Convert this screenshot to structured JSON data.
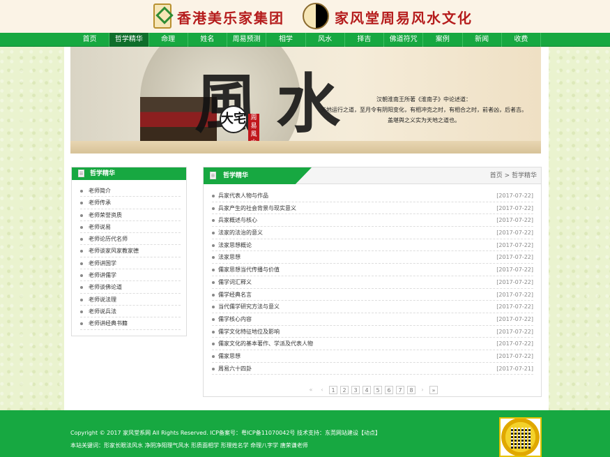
{
  "header": {
    "company_name": "香港美乐家集团",
    "brand_name": "家风堂周易风水文化"
  },
  "nav": {
    "items": [
      {
        "label": "首页",
        "active": false
      },
      {
        "label": "哲学精华",
        "active": true
      },
      {
        "label": "命理",
        "active": false
      },
      {
        "label": "姓名",
        "active": false
      },
      {
        "label": "周易预测",
        "active": false
      },
      {
        "label": "相学",
        "active": false
      },
      {
        "label": "风水",
        "active": false
      },
      {
        "label": "择吉",
        "active": false
      },
      {
        "label": "佛道符咒",
        "active": false
      },
      {
        "label": "案例",
        "active": false
      },
      {
        "label": "新闻",
        "active": false
      },
      {
        "label": "收费",
        "active": false
      }
    ]
  },
  "banner": {
    "char1": "風",
    "char2": "水",
    "seal": "大宅",
    "red_tag": "周易風水",
    "quote_line1": "汉朝淮南王所著《淮南子》中论述道：",
    "quote_line2": "天地运行之道，至月令有阴阳变化，有相冲克之时，有相合之时，前者凶，后者吉。",
    "quote_line3": "盖堪舆之义实为天地之道也。"
  },
  "sidebar": {
    "title": "哲学精华",
    "items": [
      "老师简介",
      "老师传承",
      "老师荣誉资质",
      "老师说易",
      "老师论历代名师",
      "老师谈家风家教家德",
      "老师讲国学",
      "老师讲儒学",
      "老师谈佛论道",
      "老师说法理",
      "老师说兵法",
      "老师讲经典书籍"
    ]
  },
  "content": {
    "title": "哲学精华",
    "breadcrumb": "首页 > 哲学精华",
    "articles": [
      {
        "title": "兵家代表人物与作品",
        "date": "[2017-07-22]"
      },
      {
        "title": "兵家产生的社会背景与现实意义",
        "date": "[2017-07-22]"
      },
      {
        "title": "兵家概述与核心",
        "date": "[2017-07-22]"
      },
      {
        "title": "法家的法治的意义",
        "date": "[2017-07-22]"
      },
      {
        "title": "法家思想概论",
        "date": "[2017-07-22]"
      },
      {
        "title": "法家思想",
        "date": "[2017-07-22]"
      },
      {
        "title": "儒家思想当代传播与价值",
        "date": "[2017-07-22]"
      },
      {
        "title": "儒学词汇释义",
        "date": "[2017-07-22]"
      },
      {
        "title": "儒学经典名言",
        "date": "[2017-07-22]"
      },
      {
        "title": "当代儒学研究方法与意义",
        "date": "[2017-07-22]"
      },
      {
        "title": "儒学核心内容",
        "date": "[2017-07-22]"
      },
      {
        "title": "儒学文化特征地位及影响",
        "date": "[2017-07-22]"
      },
      {
        "title": "儒家文化的基本著作、学派及代表人物",
        "date": "[2017-07-22]"
      },
      {
        "title": "儒家思想",
        "date": "[2017-07-22]"
      },
      {
        "title": "周易六十四卦",
        "date": "[2017-07-21]"
      }
    ],
    "pager": {
      "first": "«",
      "prev": "‹",
      "pages": [
        "1",
        "2",
        "3",
        "4",
        "5",
        "6",
        "7",
        "8"
      ],
      "next": "›",
      "last": "»"
    }
  },
  "footer": {
    "copyright": "Copyright © 2017 家风堂系网 All Rights Reserved.   ICP备案号：粤ICP备11070042号   技术支持：东莞网站建设【动点】",
    "keywords": "本站关键词：形家长眼法风水 净阴净阳理气风水 形质面相学 形理姓名学 命理八字学 唐荣谦老师"
  },
  "colors": {
    "brand_green": "#17a841",
    "nav_active": "#0f6e2b",
    "logo_red": "#b51c1c"
  }
}
